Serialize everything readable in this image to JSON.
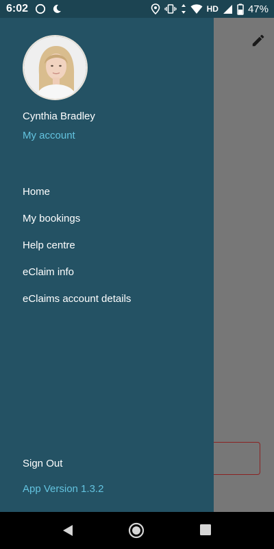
{
  "status_bar": {
    "time": "6:02",
    "network_label": "HD",
    "battery_percent": "47%",
    "icons": [
      "sync-icon",
      "do-not-disturb-icon",
      "location-icon",
      "vibrate-icon",
      "data-arrows-icon",
      "wifi-icon",
      "signal-icon",
      "battery-icon"
    ]
  },
  "drawer": {
    "user_name": "Cynthia Bradley",
    "account_link": "My account",
    "menu_items": [
      {
        "label": "Home"
      },
      {
        "label": "My bookings"
      },
      {
        "label": "Help centre"
      },
      {
        "label": "eClaim info"
      },
      {
        "label": "eClaims account details"
      }
    ],
    "sign_out": "Sign Out",
    "app_version": "App Version 1.3.2"
  },
  "background_app": {
    "action_icon": "edit-pencil-icon"
  },
  "nav_bar": {
    "buttons": [
      "back-icon",
      "home-icon",
      "recents-icon"
    ]
  },
  "colors": {
    "drawer_bg": "#245264",
    "status_bar_bg": "#1c4452",
    "accent_link": "#63c3df",
    "scrim": "#6b6b6b"
  }
}
